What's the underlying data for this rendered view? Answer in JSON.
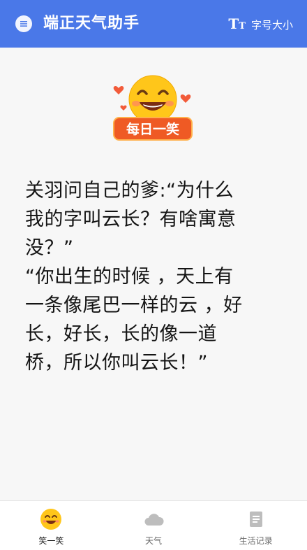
{
  "header": {
    "title": "端正天气助手",
    "font_size_icon_text": "T",
    "font_size_icon_small": "T",
    "font_size_label": "字号大小",
    "bg_color": "#4a78e8"
  },
  "badge": {
    "label": "每日一笑",
    "icon": "smiley-face-icon"
  },
  "joke": {
    "lines": [
      "关羽问自己的爹:“为什么",
      "我的字叫云长？有啥寓意",
      "没？”",
      "“你出生的时候 ，天上有",
      "一条像尾巴一样的云 ，好",
      "长，好长，长的像一道",
      "桥，所以你叫云长！”"
    ]
  },
  "bottom_nav": {
    "items": [
      {
        "label": "笑一笑",
        "icon": "smiley-icon",
        "active": true
      },
      {
        "label": "天气",
        "icon": "cloud-icon",
        "active": false
      },
      {
        "label": "生活记录",
        "icon": "document-icon",
        "active": false
      }
    ]
  }
}
